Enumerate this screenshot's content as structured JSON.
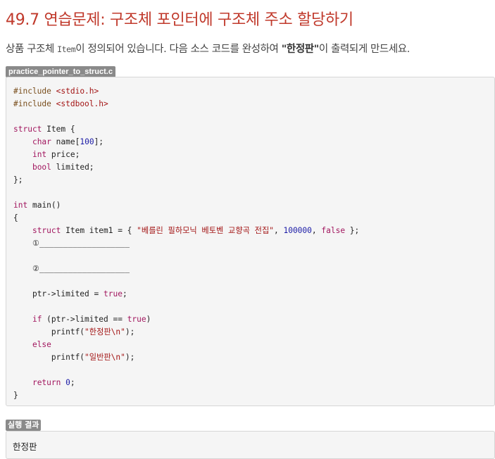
{
  "heading": "49.7 연습문제: 구조체 포인터에 구조체 주소 할당하기",
  "description": {
    "before": "상품 구조체 ",
    "code_term": "Item",
    "middle": "이 정의되어 있습니다. 다음 소스 코드를 완성하여 ",
    "emphasis": "\"한정판\"",
    "after": "이 출력되게 만드세요."
  },
  "file_label": "practice_pointer_to_struct.c",
  "code": {
    "include1": "#include",
    "include1_file": "<stdio.h>",
    "include2": "#include",
    "include2_file": "<stdbool.h>",
    "kw_struct": "struct",
    "struct_name": "Item {",
    "kw_char": "char",
    "field_name": "name[",
    "field_name_size": "100",
    "field_name_end": "];",
    "kw_int": "int",
    "field_price": "price;",
    "kw_bool": "bool",
    "field_limited": "limited;",
    "struct_close": "};",
    "main_kw": "int",
    "main_sig": "main()",
    "brace_open": "{",
    "item_decl": "Item item1 = { ",
    "item_name": "\"베를린 필하모닉 베토벤 교향곡 전집\"",
    "item_sep": ", ",
    "item_price": "100000",
    "item_false": "false",
    "item_end": " };",
    "blank1": "①___________________",
    "blank2": "②___________________",
    "assign_ptr": "ptr->limited = ",
    "assign_true": "true",
    "assign_end": ";",
    "if_kw": "if",
    "if_cond": " (ptr->limited == ",
    "if_true": "true",
    "if_close": ")",
    "printf1": "printf(",
    "printf1_str": "\"한정판\\n\"",
    "printf_end1": ");",
    "else_kw": "else",
    "printf2": "printf(",
    "printf2_str": "\"일반판\\n\"",
    "printf_end2": ");",
    "return_kw": "return",
    "return_val": "0",
    "return_end": ";",
    "brace_close": "}"
  },
  "result_label": "실행 결과",
  "result_output": "한정판"
}
